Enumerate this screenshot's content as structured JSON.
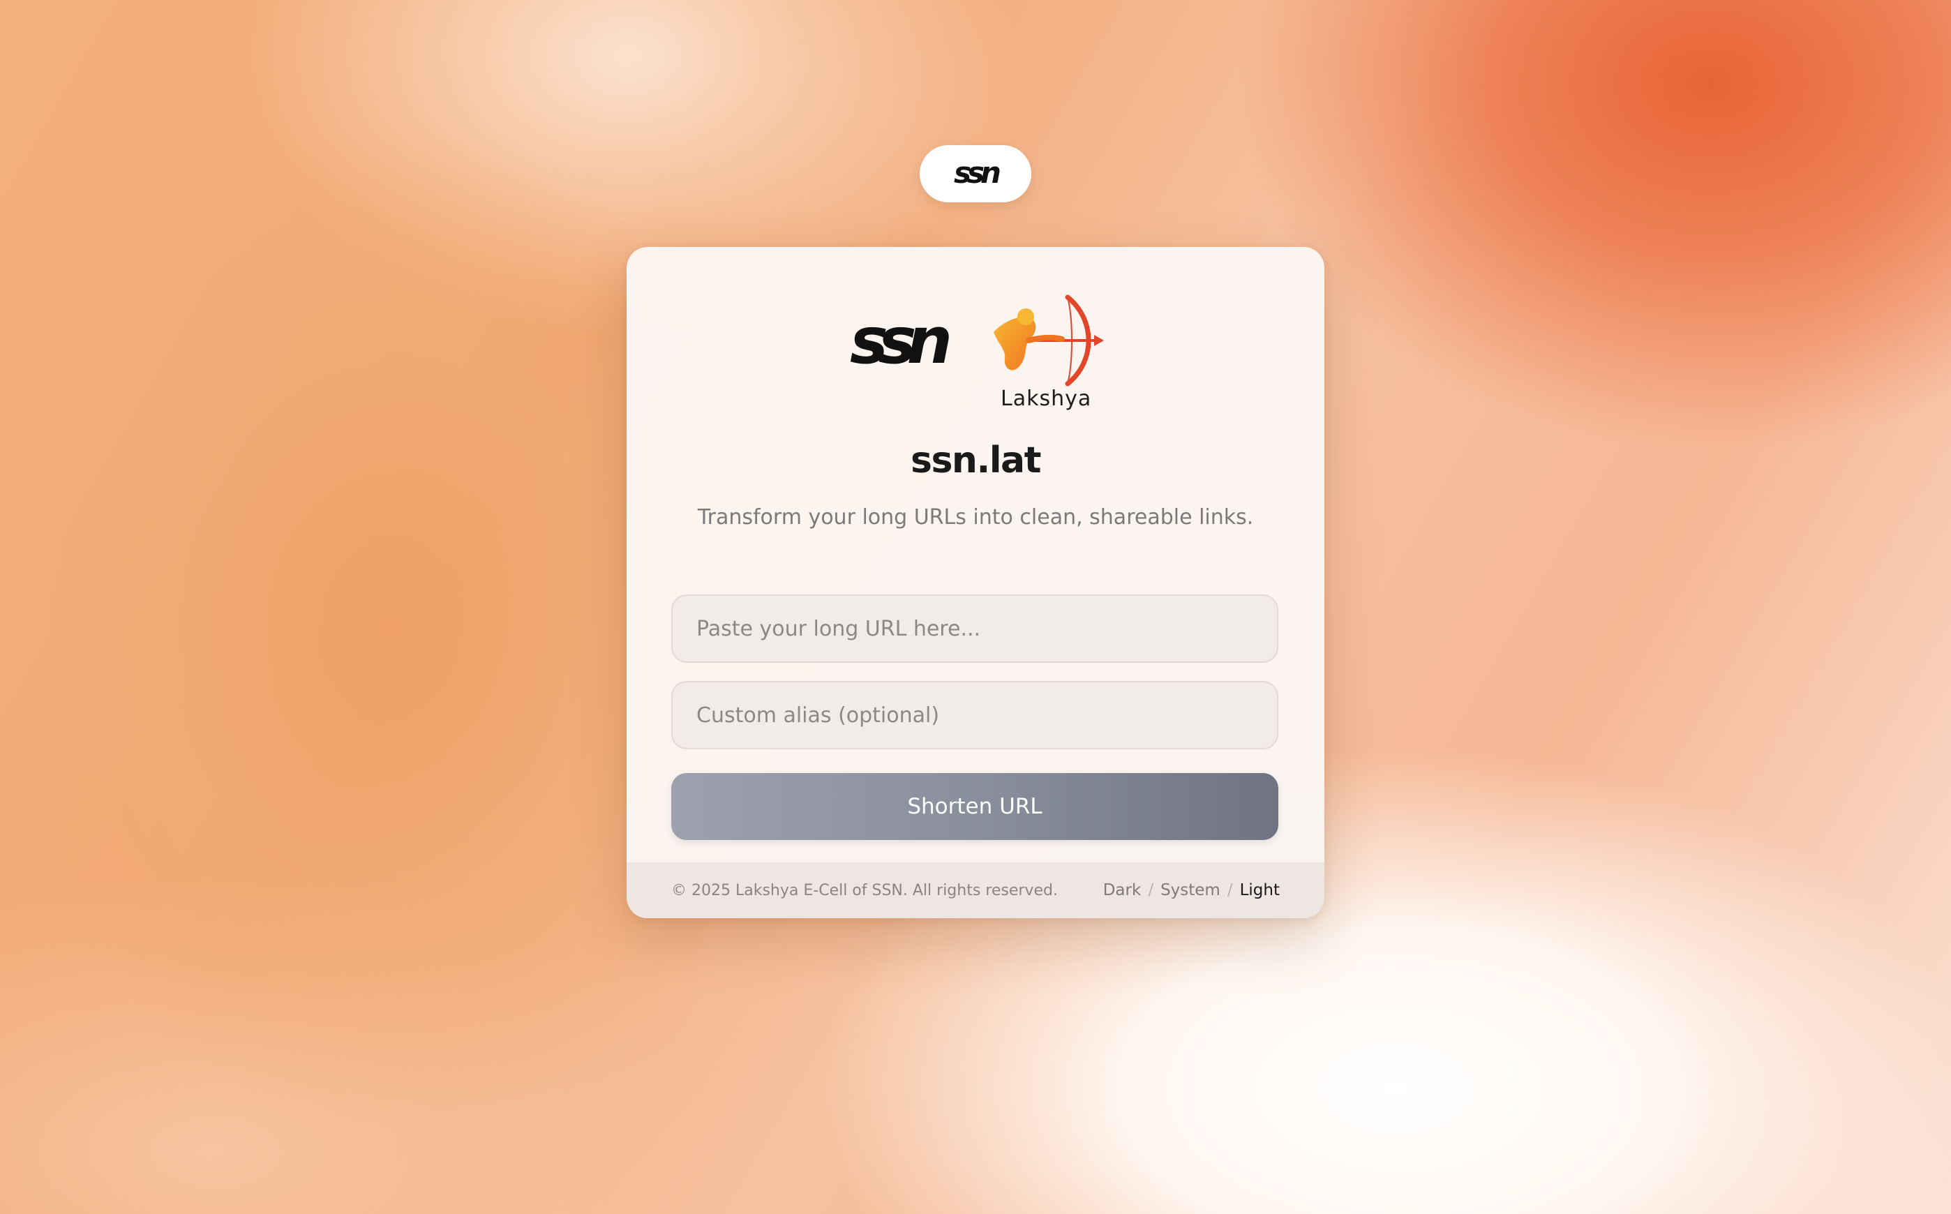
{
  "header": {
    "logo_text": "ssn"
  },
  "card": {
    "logos": {
      "ssn_logo_text": "ssn",
      "partner_logo_caption": "Lakshya"
    },
    "title": "ssn.lat",
    "subtitle": "Transform your long URLs into clean, shareable links.",
    "form": {
      "url_input": {
        "value": "",
        "placeholder": "Paste your long URL here..."
      },
      "alias_input": {
        "value": "",
        "placeholder": "Custom alias (optional)"
      },
      "submit_label": "Shorten URL"
    },
    "footer": {
      "copyright": "© 2025 Lakshya E-Cell of SSN. All rights reserved.",
      "theme_options": [
        "Dark",
        "System",
        "Light"
      ],
      "theme_separator": "/",
      "selected_theme": "Light"
    }
  },
  "colors": {
    "button_gradient_start": "#9ca1ad",
    "button_gradient_end": "#6f7483",
    "lakshya_orange": "#f08a24",
    "lakshya_red": "#e2452a"
  },
  "icons": {
    "pill_logo": "ssn-logo-icon",
    "partner_logo": "lakshya-archer-icon"
  }
}
